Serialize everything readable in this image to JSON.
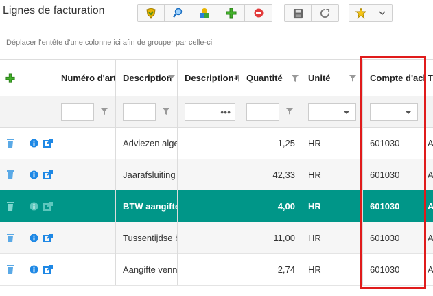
{
  "title": "Lignes de facturation",
  "group_hint": "Déplacer l'entête d'une colonne ici afin de grouper par celle-ci",
  "toolbar": {
    "group1": [
      "shield-icon",
      "search-icon",
      "shapes-icon",
      "add-icon",
      "cancel-icon"
    ],
    "group2": [
      "save-icon",
      "refresh-icon"
    ],
    "favorites": "star-icon"
  },
  "columns": {
    "numero": "Numéro d'artic",
    "description": "Description",
    "description_plus": "Description+",
    "quantite": "Quantité",
    "unite": "Unité",
    "compte": "Compte d'acha",
    "last": "T"
  },
  "rows": [
    {
      "description": "Adviezen algen",
      "quantite": "1,25",
      "unite": "HR",
      "compte": "601030",
      "last": "A"
    },
    {
      "description": "Jaarafsluiting",
      "quantite": "42,33",
      "unite": "HR",
      "compte": "601030",
      "last": "A"
    },
    {
      "description": "BTW aangifte",
      "quantite": "4,00",
      "unite": "HR",
      "compte": "601030",
      "last": "A",
      "selected": true
    },
    {
      "description": "Tussentijdse b",
      "quantite": "11,00",
      "unite": "HR",
      "compte": "601030",
      "last": "A"
    },
    {
      "description": "Aangifte venno",
      "quantite": "2,74",
      "unite": "HR",
      "compte": "601030",
      "last": "A"
    }
  ],
  "colors": {
    "selected": "#009688",
    "highlight_box": "#e01b1b",
    "accent_blue": "#1e88e5"
  }
}
